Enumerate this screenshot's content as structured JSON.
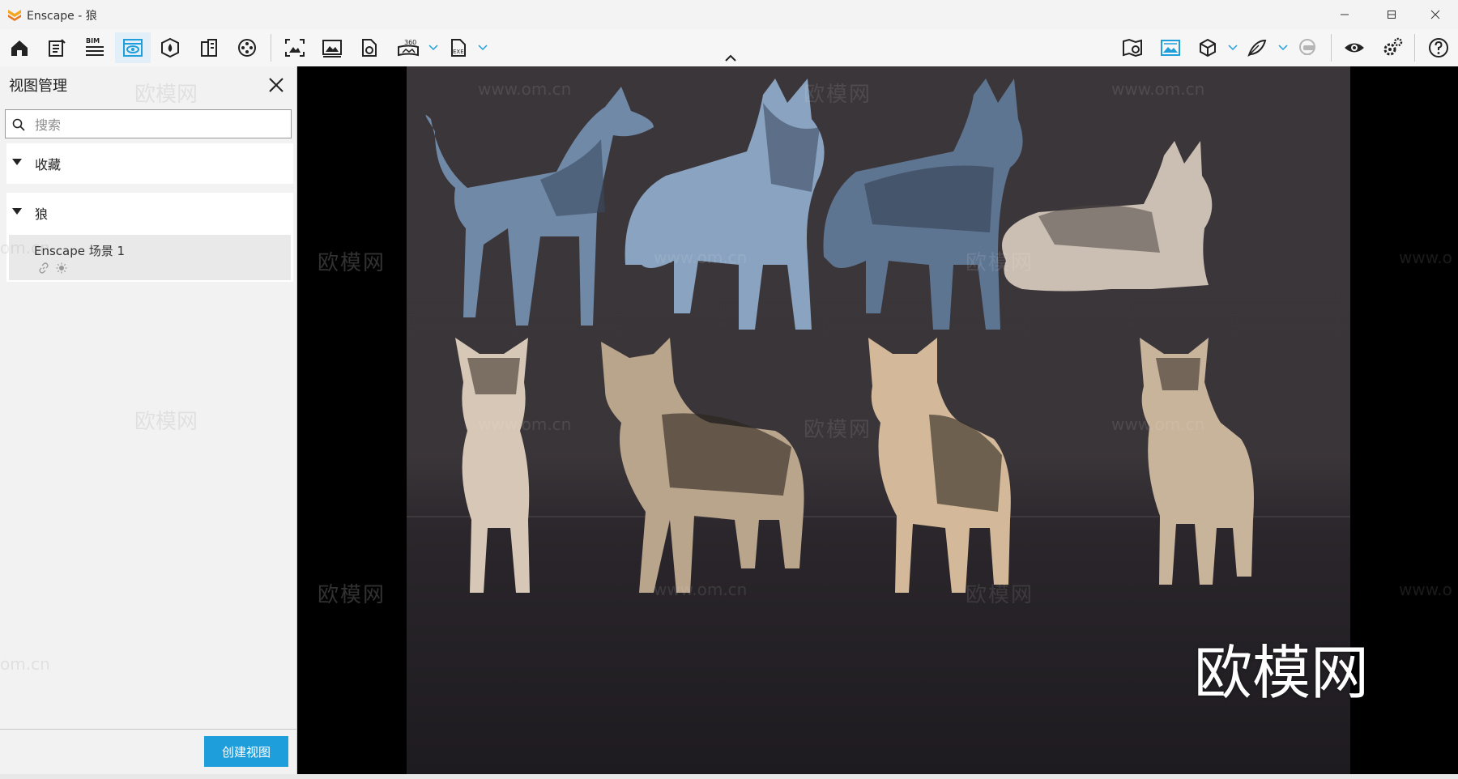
{
  "window": {
    "title": "Enscape - 狼"
  },
  "toolbar": {
    "bim_label": "BIM",
    "pano_label": "360",
    "exe_label": "EXE",
    "accent": "#1e9fdc"
  },
  "sidebar": {
    "title": "视图管理",
    "search_placeholder": "搜索",
    "sections": [
      {
        "label": "收藏"
      },
      {
        "label": "狼",
        "items": [
          {
            "name": "Enscape 场景 1"
          }
        ]
      }
    ],
    "create_button": "创建视图"
  },
  "viewport": {
    "watermark_text": "欧模网",
    "watermark_url": "www.om.cn",
    "watermark_url_partial": "om.cn",
    "watermark_url_cut": "www.o"
  }
}
